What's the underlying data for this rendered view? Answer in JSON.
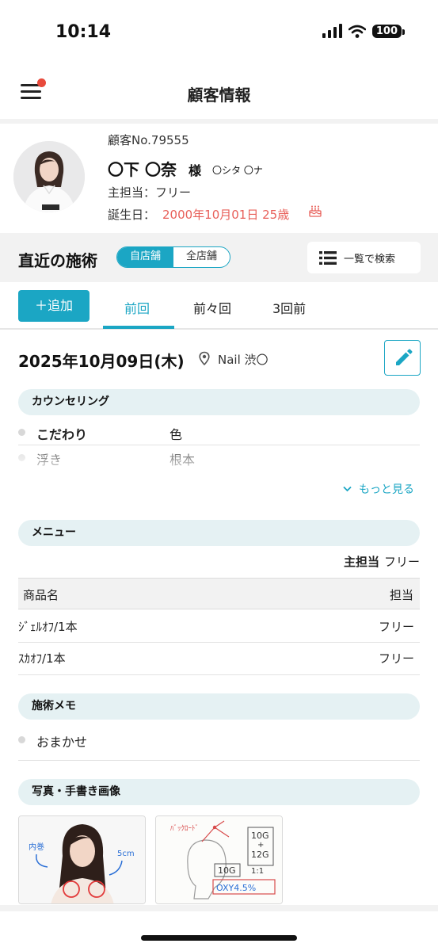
{
  "status_bar": {
    "time": "10:14",
    "battery": "100"
  },
  "header": {
    "title": "顧客情報"
  },
  "customer": {
    "number": "顧客No.79555",
    "name": "〇下 〇奈",
    "honorific": "様",
    "kana": "〇シタ 〇ナ",
    "staff": "主担当：フリー",
    "birthday_label": "誕生日：",
    "birthday": "2000年10月01日 25歳"
  },
  "recent": {
    "title": "直近の施術",
    "toggle": [
      "自店舗",
      "全店舗"
    ],
    "search_label": "一覧で検索"
  },
  "tabs": {
    "add_label": "＋追加",
    "items": [
      "前回",
      "前々回",
      "3回前"
    ],
    "active_index": 0
  },
  "visit": {
    "date": "2025年10月09日(木)",
    "store": "Nail 渋〇"
  },
  "counseling": {
    "title": "カウンセリング",
    "rows": [
      {
        "label": "こだわり",
        "value": "色"
      },
      {
        "label": "浮き",
        "value": "根本"
      }
    ],
    "more_label": "もっと見る"
  },
  "menu": {
    "title": "メニュー",
    "staff_label": "主担当",
    "staff_value": "フリー",
    "columns": [
      "商品名",
      "担当"
    ],
    "rows": [
      {
        "name": "ｼﾞｪﾙｵﾌ/1本",
        "staff": "フリー"
      },
      {
        "name": "ｽｶｵﾌ/1本",
        "staff": "フリー"
      }
    ]
  },
  "memo": {
    "title": "施術メモ",
    "text": "おまかせ"
  },
  "images": {
    "title": "写真・手書き画像",
    "photo1": {
      "left_note": "内巻",
      "right_note": "5cm"
    },
    "photo2": {
      "top_note": "ﾊﾞｯｸﾛｰﾄﾞ",
      "box1": "10G",
      "plus": "+",
      "box2": "12G",
      "ratio": "1:1",
      "box3": "10G",
      "formula": "OXY4.5%"
    }
  },
  "colors": {
    "accent": "#1ba6c4",
    "birthday": "#e8605a",
    "notify_dot": "#e84a3c"
  }
}
